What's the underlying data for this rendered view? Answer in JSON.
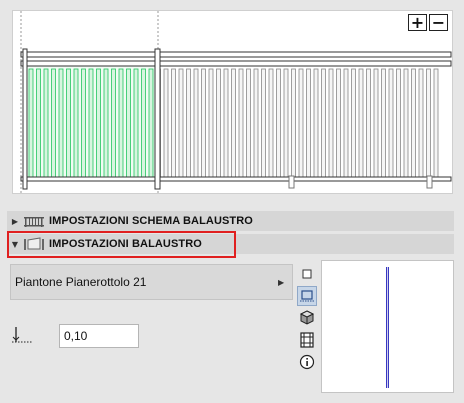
{
  "preview": {
    "zoom_in_label": "+",
    "zoom_out_label": "−",
    "highlight_color": "#22c55e",
    "rail_color": "#333333"
  },
  "sections": [
    {
      "label": "IMPOSTAZIONI SCHEMA BALAUSTRO",
      "expanded": false
    },
    {
      "label": "IMPOSTAZIONI BALAUSTRO",
      "expanded": true
    }
  ],
  "dropdown": {
    "selected": "Piantone Pianerottolo 21"
  },
  "offset": {
    "value": "0,10"
  },
  "toolbar_icons": [
    "square-icon",
    "post-view-icon",
    "cube-icon",
    "film-strip-icon",
    "info-icon"
  ],
  "accent": {
    "highlight_border": "#e02020",
    "selected_tool_bg": "#c7d6e8",
    "post_color": "#3838c0"
  }
}
